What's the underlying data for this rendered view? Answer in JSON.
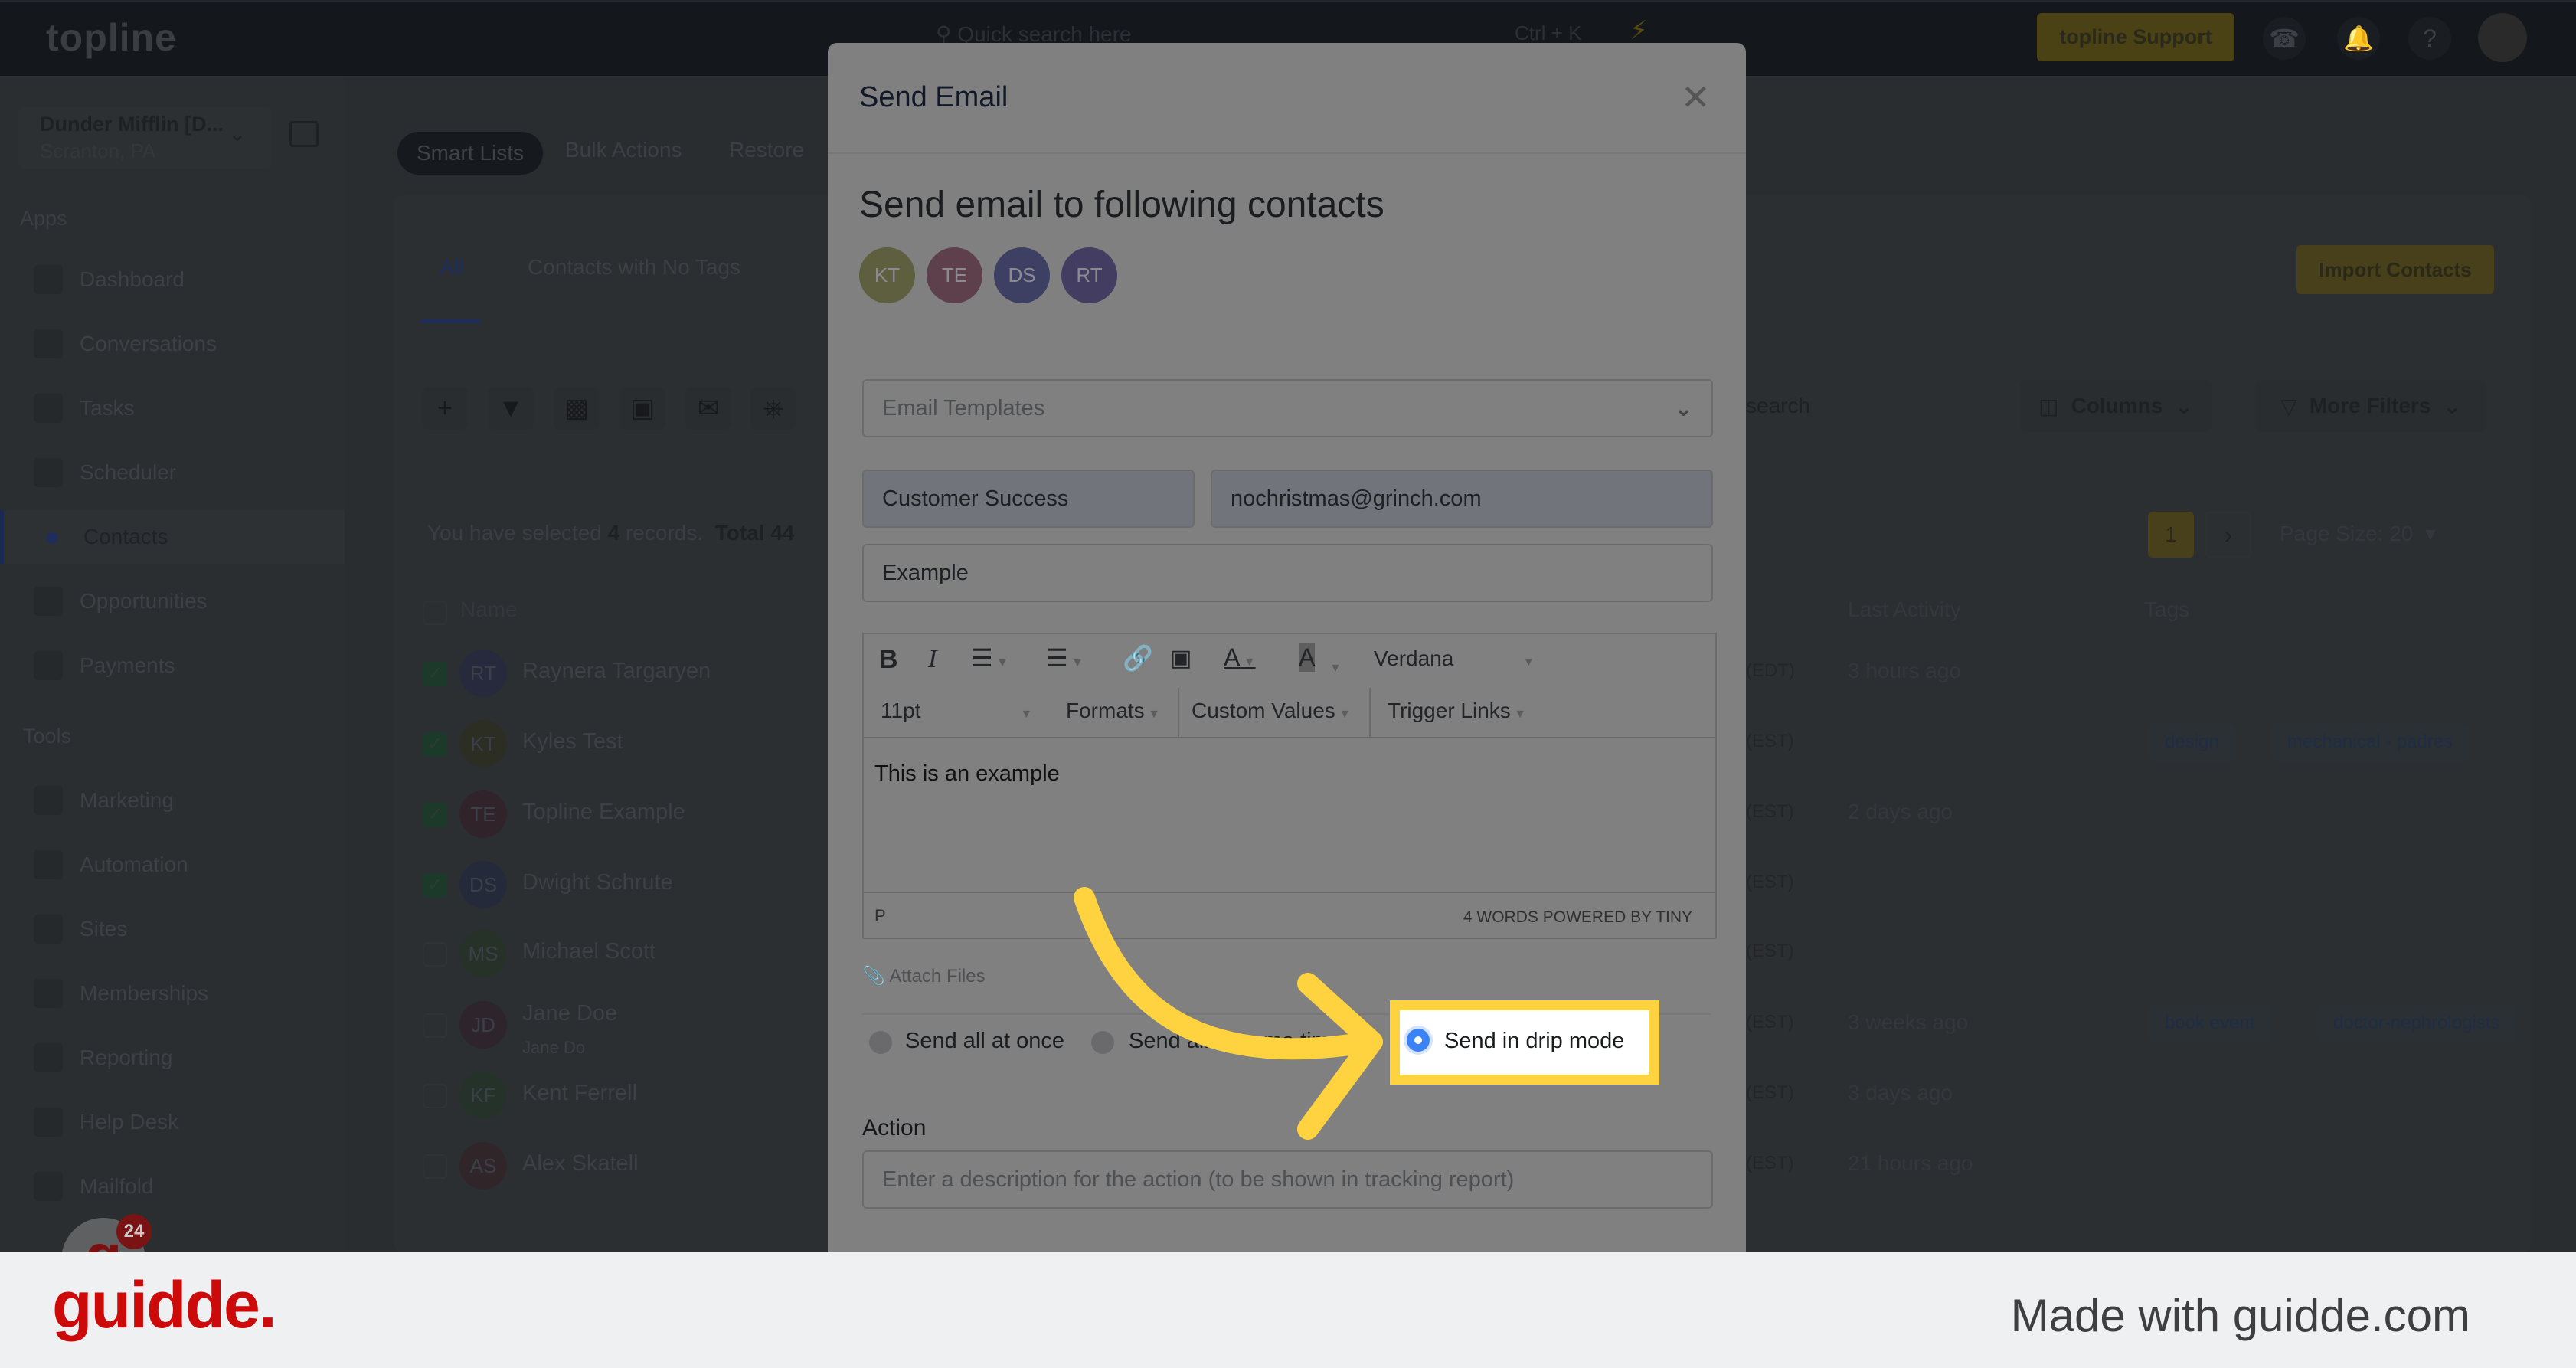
{
  "topbar": {
    "logo": "topline",
    "search_placeholder": "Quick search here",
    "shortcut": "Ctrl + K",
    "support_label": "topline Support",
    "icons": [
      "search-icon",
      "lightning-icon",
      "phone-icon",
      "bell-icon",
      "help-icon",
      "avatar"
    ]
  },
  "sidebar": {
    "account_name": "Dunder Mifflin [D...",
    "account_location": "Scranton, PA",
    "apps_label": "Apps",
    "tools_label": "Tools",
    "apps": [
      {
        "label": "Dashboard",
        "icon": "dashboard-icon"
      },
      {
        "label": "Conversations",
        "icon": "chat-icon"
      },
      {
        "label": "Tasks",
        "icon": "tasks-icon"
      },
      {
        "label": "Scheduler",
        "icon": "calendar-icon"
      },
      {
        "label": "Contacts",
        "icon": "person-icon",
        "active": true
      },
      {
        "label": "Opportunities",
        "icon": "target-icon"
      },
      {
        "label": "Payments",
        "icon": "card-icon"
      }
    ],
    "tools": [
      {
        "label": "Marketing",
        "icon": "megaphone-icon"
      },
      {
        "label": "Automation",
        "icon": "gears-icon"
      },
      {
        "label": "Sites",
        "icon": "globe-icon"
      },
      {
        "label": "Memberships",
        "icon": "members-icon"
      },
      {
        "label": "Reporting",
        "icon": "pie-icon"
      },
      {
        "label": "Help Desk",
        "icon": "help-icon"
      },
      {
        "label": "Mailfold",
        "icon": "mail-icon"
      }
    ],
    "chat_badge": "24"
  },
  "main": {
    "subtabs": [
      "Smart Lists",
      "Bulk Actions",
      "Restore"
    ],
    "tabs": [
      "All",
      "Contacts with No Tags"
    ],
    "selection": {
      "prefix": "You have selected",
      "count": "4",
      "suffix": "records.",
      "total": "Total 44"
    },
    "search_placeholder": "search",
    "columns_label": "Columns",
    "more_filters_label": "More Filters",
    "import_label": "Import Contacts",
    "page": "1",
    "page_size": "Page Size: 20",
    "headers": {
      "name": "Name",
      "last_activity": "Last Activity",
      "tags": "Tags"
    },
    "rows": [
      {
        "initials": "RT",
        "name": "Raynera Targaryen",
        "checked": true,
        "tz": "(EDT)",
        "last": "3 hours ago",
        "tags": [],
        "color": "#262a3c"
      },
      {
        "initials": "KT",
        "name": "Kyles Test",
        "checked": true,
        "tz": "(EST)",
        "last": "",
        "tags": [
          "design",
          "mechanical - padres"
        ],
        "color": "#2c2e24"
      },
      {
        "initials": "TE",
        "name": "Topline Example",
        "checked": true,
        "tz": "(EST)",
        "last": "2 days ago",
        "tags": [],
        "color": "#30242a"
      },
      {
        "initials": "DS",
        "name": "Dwight Schrute",
        "checked": true,
        "tz": "(EST)",
        "last": "",
        "tags": [],
        "color": "#252a3a"
      },
      {
        "initials": "MS",
        "name": "Michael Scott",
        "checked": false,
        "tz": "(EST)",
        "last": "",
        "tags": [],
        "color": "#263228"
      },
      {
        "initials": "JD",
        "name": "Jane Doe",
        "sub": "Jane Do",
        "checked": false,
        "tz": "(EST)",
        "last": "3 weeks ago",
        "tags": [
          "book event",
          "doctor-nephrologists"
        ],
        "color": "#2e252c"
      },
      {
        "initials": "KF",
        "name": "Kent Ferrell",
        "checked": false,
        "tz": "(EST)",
        "last": "3 days ago",
        "tags": [],
        "color": "#24322a"
      },
      {
        "initials": "AS",
        "name": "Alex Skatell",
        "checked": false,
        "tz": "(EST)",
        "last": "21 hours ago",
        "tags": [],
        "color": "#30262a"
      }
    ]
  },
  "modal": {
    "title": "Send Email",
    "heading": "Send email to following contacts",
    "recipients": [
      {
        "initials": "KT",
        "color": "#5e5f3e"
      },
      {
        "initials": "TE",
        "color": "#5e3f4c"
      },
      {
        "initials": "DS",
        "color": "#3e4063"
      },
      {
        "initials": "RT",
        "color": "#433d62"
      }
    ],
    "template_placeholder": "Email Templates",
    "from_name": "Customer Success",
    "from_email": "nochristmas@grinch.com",
    "subject": "Example",
    "editor": {
      "font": "Verdana",
      "size": "11pt",
      "formats": "Formats",
      "custom_values": "Custom Values",
      "trigger_links": "Trigger Links",
      "body": "This is an example",
      "path": "P",
      "status": "4 WORDS POWERED BY TINY"
    },
    "attach_label": "Attach Files",
    "send_options": [
      "Send all at once",
      "Send all at some time",
      "Send in drip mode"
    ],
    "selected_option": "Send in drip mode",
    "action_label": "Action",
    "action_placeholder": "Enter a description for the action (to be shown in tracking report)"
  },
  "highlight_color": "#ffd23f",
  "footer": {
    "logo": "guidde.",
    "made_with": "Made with guidde.com",
    "brand_color": "#cc0a0a"
  }
}
